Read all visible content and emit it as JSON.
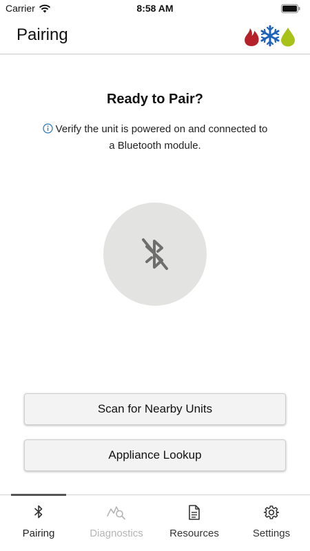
{
  "status_bar": {
    "carrier": "Carrier",
    "time": "8:58 AM"
  },
  "header": {
    "title": "Pairing",
    "logo_icons": [
      "flame-icon",
      "snowflake-icon",
      "droplet-icon"
    ]
  },
  "main": {
    "heading": "Ready to Pair?",
    "info_text": "Verify the unit is powered on and connected to a Bluetooth module.",
    "info_icon": "info-circle-icon",
    "status_icon": "bluetooth-disabled-icon",
    "buttons": {
      "scan": "Scan for Nearby Units",
      "lookup": "Appliance Lookup"
    }
  },
  "tab_bar": {
    "tabs": [
      {
        "label": "Pairing",
        "icon": "bluetooth-icon",
        "state": "selected"
      },
      {
        "label": "Diagnostics",
        "icon": "diagnostics-icon",
        "state": "disabled"
      },
      {
        "label": "Resources",
        "icon": "document-icon",
        "state": "normal"
      },
      {
        "label": "Settings",
        "icon": "gear-icon",
        "state": "normal"
      }
    ]
  },
  "colors": {
    "flame": "#b5212b",
    "snowflake": "#1e63b8",
    "droplet": "#a8c21a",
    "info": "#2b7bc0",
    "circle": "#e3e3e1",
    "disabled_tab": "#b5b5b5"
  }
}
